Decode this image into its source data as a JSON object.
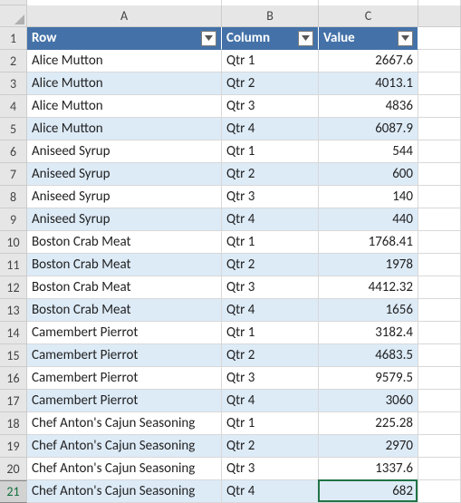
{
  "chart_data": {
    "type": "table",
    "columns": [
      "Row",
      "Column",
      "Value"
    ],
    "rows": [
      [
        "Alice Mutton",
        "Qtr 1",
        2667.6
      ],
      [
        "Alice Mutton",
        "Qtr 2",
        4013.1
      ],
      [
        "Alice Mutton",
        "Qtr 3",
        4836
      ],
      [
        "Alice Mutton",
        "Qtr 4",
        6087.9
      ],
      [
        "Aniseed Syrup",
        "Qtr 1",
        544
      ],
      [
        "Aniseed Syrup",
        "Qtr 2",
        600
      ],
      [
        "Aniseed Syrup",
        "Qtr 3",
        140
      ],
      [
        "Aniseed Syrup",
        "Qtr 4",
        440
      ],
      [
        "Boston Crab Meat",
        "Qtr 1",
        1768.41
      ],
      [
        "Boston Crab Meat",
        "Qtr 2",
        1978
      ],
      [
        "Boston Crab Meat",
        "Qtr 3",
        4412.32
      ],
      [
        "Boston Crab Meat",
        "Qtr 4",
        1656
      ],
      [
        "Camembert Pierrot",
        "Qtr 1",
        3182.4
      ],
      [
        "Camembert Pierrot",
        "Qtr 2",
        4683.5
      ],
      [
        "Camembert Pierrot",
        "Qtr 3",
        9579.5
      ],
      [
        "Camembert Pierrot",
        "Qtr 4",
        3060
      ],
      [
        "Chef Anton's Cajun Seasoning",
        "Qtr 1",
        225.28
      ],
      [
        "Chef Anton's Cajun Seasoning",
        "Qtr 2",
        2970
      ],
      [
        "Chef Anton's Cajun Seasoning",
        "Qtr 3",
        1337.6
      ],
      [
        "Chef Anton's Cajun Seasoning",
        "Qtr 4",
        682
      ]
    ]
  },
  "columns": {
    "letters": [
      "A",
      "B",
      "C"
    ],
    "headerA": "Row",
    "headerB": "Column",
    "headerC": "Value"
  },
  "rows": [
    {
      "n": "2",
      "a": "Alice Mutton",
      "b": "Qtr 1",
      "c": "2667.6"
    },
    {
      "n": "3",
      "a": "Alice Mutton",
      "b": "Qtr 2",
      "c": "4013.1"
    },
    {
      "n": "4",
      "a": "Alice Mutton",
      "b": "Qtr 3",
      "c": "4836"
    },
    {
      "n": "5",
      "a": "Alice Mutton",
      "b": "Qtr 4",
      "c": "6087.9"
    },
    {
      "n": "6",
      "a": "Aniseed Syrup",
      "b": "Qtr 1",
      "c": "544"
    },
    {
      "n": "7",
      "a": "Aniseed Syrup",
      "b": "Qtr 2",
      "c": "600"
    },
    {
      "n": "8",
      "a": "Aniseed Syrup",
      "b": "Qtr 3",
      "c": "140"
    },
    {
      "n": "9",
      "a": "Aniseed Syrup",
      "b": "Qtr 4",
      "c": "440"
    },
    {
      "n": "10",
      "a": "Boston Crab Meat",
      "b": "Qtr 1",
      "c": "1768.41"
    },
    {
      "n": "11",
      "a": "Boston Crab Meat",
      "b": "Qtr 2",
      "c": "1978"
    },
    {
      "n": "12",
      "a": "Boston Crab Meat",
      "b": "Qtr 3",
      "c": "4412.32"
    },
    {
      "n": "13",
      "a": "Boston Crab Meat",
      "b": "Qtr 4",
      "c": "1656"
    },
    {
      "n": "14",
      "a": "Camembert Pierrot",
      "b": "Qtr 1",
      "c": "3182.4"
    },
    {
      "n": "15",
      "a": "Camembert Pierrot",
      "b": "Qtr 2",
      "c": "4683.5"
    },
    {
      "n": "16",
      "a": "Camembert Pierrot",
      "b": "Qtr 3",
      "c": "9579.5"
    },
    {
      "n": "17",
      "a": "Camembert Pierrot",
      "b": "Qtr 4",
      "c": "3060"
    },
    {
      "n": "18",
      "a": "Chef Anton's Cajun Seasoning",
      "b": "Qtr 1",
      "c": "225.28"
    },
    {
      "n": "19",
      "a": "Chef Anton's Cajun Seasoning",
      "b": "Qtr 2",
      "c": "2970"
    },
    {
      "n": "20",
      "a": "Chef Anton's Cajun Seasoning",
      "b": "Qtr 3",
      "c": "1337.6"
    },
    {
      "n": "21",
      "a": "Chef Anton's Cajun Seasoning",
      "b": "Qtr 4",
      "c": "682"
    }
  ],
  "rowHeader1": "1",
  "selectedRow": "21"
}
